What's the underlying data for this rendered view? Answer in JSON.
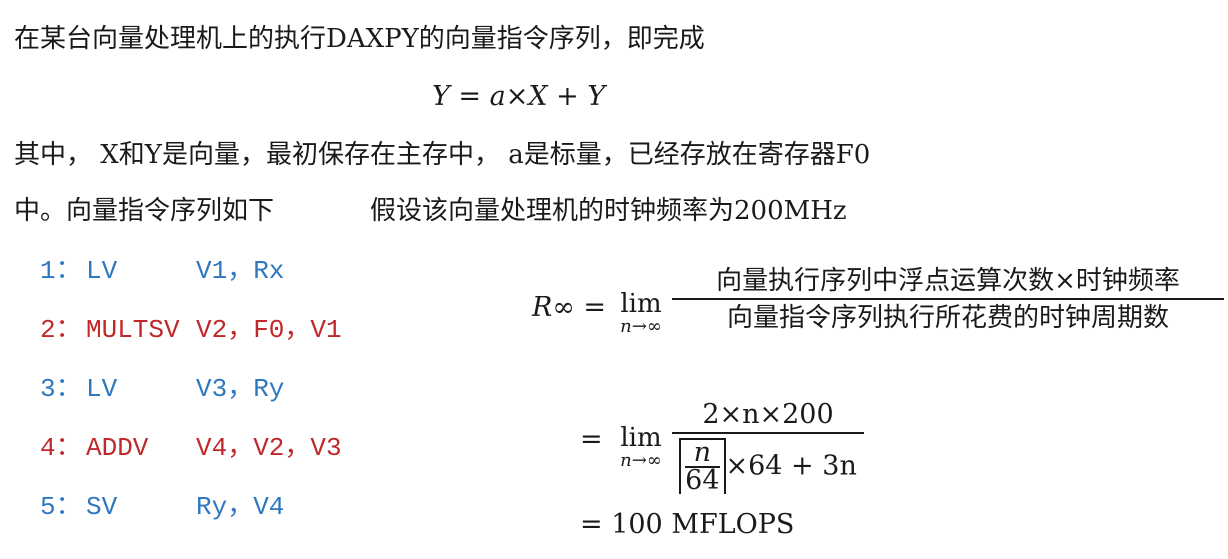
{
  "intro": {
    "line1": "在某台向量处理机上的执行DAXPY的向量指令序列，即完成",
    "equation": "Y = a×X + Y",
    "line2": "其中， X和Y是向量，最初保存在主存中， a是标量，已经存放在寄存器F0",
    "line3": "中。向量指令序列如下",
    "line3b": "假设该向量处理机的时钟频率为200MHz"
  },
  "instructions": [
    {
      "num": "1：",
      "op": "LV",
      "args": "V1，Rx",
      "color": "#2f78c0"
    },
    {
      "num": "2：",
      "op": "MULTSV",
      "args": "V2，F0，V1",
      "color": "#c0282a"
    },
    {
      "num": "3：",
      "op": "LV",
      "args": "V3，Ry",
      "color": "#2f78c0"
    },
    {
      "num": "4：",
      "op": "ADDV",
      "args": "V4，V2，V3",
      "color": "#c0282a"
    },
    {
      "num": "5：",
      "op": "SV",
      "args": "Ry，V4",
      "color": "#2f78c0"
    }
  ],
  "formula": {
    "lhs": "R∞ =",
    "lim_word": "lim",
    "lim_sub": "n→∞",
    "frac1_num": "向量执行序列中浮点运算次数×时钟频率",
    "frac1_den": "向量指令序列执行所花费的时钟周期数",
    "eq2": "=",
    "frac2_num": "2×n×200",
    "ceil_num": "n",
    "ceil_den": "64",
    "frac2_den_tail": "×64 + 3n",
    "result": "= 100 MFLOPS"
  }
}
